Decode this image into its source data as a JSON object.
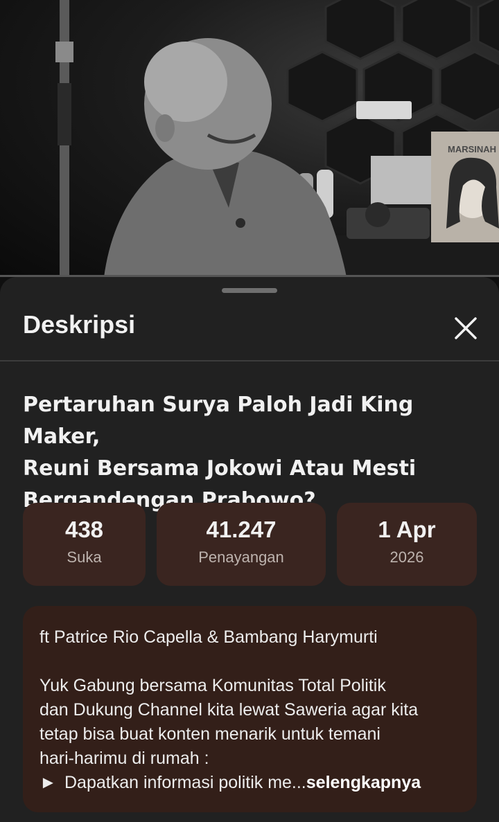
{
  "player": {
    "progress": 0
  },
  "sheet": {
    "title": "Deskripsi",
    "close_icon": "close-icon"
  },
  "video": {
    "title": "Pertaruhan Surya Paloh Jadi King Maker, Reuni Bersama Jokowi Atau Mesti Bergandengan Prabowo?",
    "title_lines": [
      "Pertaruhan Surya Paloh Jadi King Maker,",
      "Reuni Bersama Jokowi Atau Mesti",
      "Bergandengan Prabowo?"
    ],
    "poster_text": "MARSINAH"
  },
  "stats": [
    {
      "value": "438",
      "label": "Suka"
    },
    {
      "value": "41.247",
      "label": "Penayangan"
    },
    {
      "value": "1 Apr",
      "label": "2026"
    }
  ],
  "description": {
    "line1": "ft Patrice Rio Capella & Bambang Harymurti",
    "para": [
      "Yuk Gabung bersama Komunitas Total Politik",
      "dan Dukung Channel kita lewat Saweria agar kita",
      "tetap bisa buat konten menarik untuk temani",
      "hari-harimu di rumah :"
    ],
    "bullet_symbol": "►",
    "bullet_text": "Dapatkan informasi politik me...",
    "more_label": "selengkapnya"
  },
  "colors": {
    "sheet_bg": "#212121",
    "card_bg": "#3a2520",
    "desc_bg": "#331f19"
  }
}
